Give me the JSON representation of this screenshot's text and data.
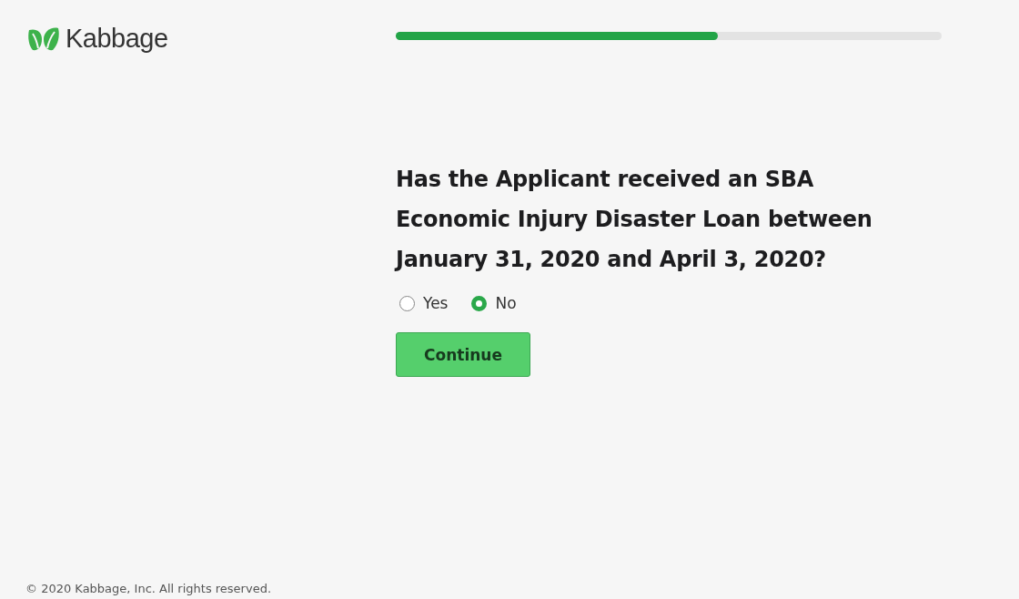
{
  "brand": {
    "name": "Kabbage"
  },
  "progress": {
    "level": 0.59
  },
  "question": "Has the Applicant received an SBA Economic Injury Disaster Loan between January 31, 2020 and April 3, 2020?",
  "options": [
    {
      "label": "Yes",
      "selected": false
    },
    {
      "label": "No",
      "selected": true
    }
  ],
  "button": "Continue",
  "footer": "© 2020 Kabbage, Inc. All rights reserved."
}
